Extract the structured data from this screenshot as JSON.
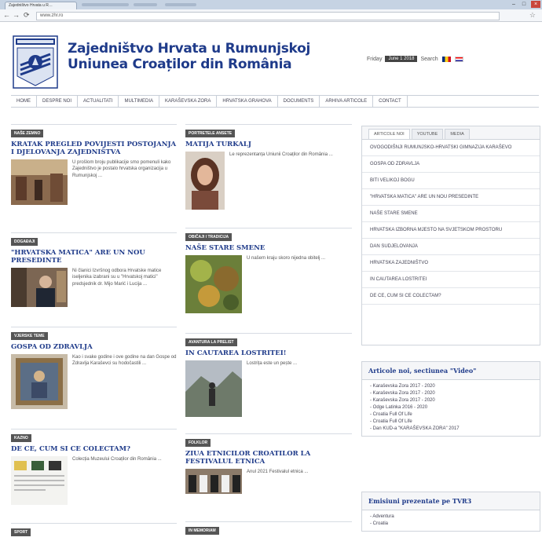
{
  "browser": {
    "tab_title": "Zajedništvo Hrvata u R…",
    "url": "www.zhr.ro"
  },
  "site": {
    "title_line1": "Zajedništvo Hrvata u Rumunjskoj",
    "title_line2": "Uniunea Croaților din România",
    "day": "Friday",
    "date": "June 1 2018",
    "search_label": "Search"
  },
  "menu": [
    "HOME",
    "DESPRE NOI",
    "ACTUALITATI",
    "MULTIMEDIA",
    "KARAŠEVSKA ZORA",
    "HRVATSKA GRAHOVA",
    "DOCUMENTS",
    "ARHIVA ARTICOLE",
    "CONTACT"
  ],
  "column1": [
    {
      "category": "NAŠE ZEMNO",
      "headline": "KRATAK PREGLED POVIJESTI POSTOJANJA I DJELOVANJA ZAJEDNIŠTVA",
      "excerpt": "U prošlom broju publikacije smo pomenuli kako Zajedništvo je postalo hrvatska organizacija u Rumunjskoj ..."
    },
    {
      "category": "DOGAĐAJI",
      "headline": "\"HRVATSKA MATICA\" ARE UN NOU PRESEDINTE",
      "excerpt": "Ni članici Izvršnog odbora Hrvatske matice iseljenika izabrani su u \"Hrvatskoj matici\" predsjednik dr. Mijo Marić i Lucija ..."
    },
    {
      "category": "VJERSKE TEME",
      "headline": "GOSPA OD ZDRAVLJA",
      "excerpt": "Kao i svake godine i ove godine na dan Gospe od Zdravlja Karaševci su hodočastili ..."
    },
    {
      "category": "KAZNO",
      "headline": "DE CE, CUM SI CE COLECTAM?",
      "excerpt": "Colecția Muzeului Croaților din România ..."
    },
    {
      "category": "SPORT",
      "headline": "",
      "excerpt": ""
    }
  ],
  "column2": [
    {
      "category": "PORTRETELE ANSETE",
      "headline": "MATIJA TURKALJ",
      "excerpt": "Le reprezentanța Uniunii Croaților din România ..."
    },
    {
      "category": "OBIČAJI I TRADICIJA",
      "headline": "NAŠE STARE SMENE",
      "excerpt": "U našem kraju skoro nijedna obitelj ..."
    },
    {
      "category": "AVANTURA LA PRELIST",
      "headline": "IN CAUTAREA LOSTRITEI!",
      "excerpt": "Lostrița este un pește ..."
    },
    {
      "category": "FOLKLOR",
      "headline": "ZIUA ETNICILOR CROATILOR LA FESTIVALUL ETNICA",
      "excerpt": "Anul 2021 Festivalul etnica ..."
    },
    {
      "category": "IN MEMORIAM",
      "headline": "",
      "excerpt": ""
    }
  ],
  "sidebar": {
    "tabs": [
      "ARTICOLE NOI",
      "YOUTUBE",
      "MEDIA"
    ],
    "articles": [
      "OVOGODIŠNJI RUMUNJSKO-HRVATSKI GIMNAZIJA KARAŠEVO",
      "GOSPA OD ZDRAVLJA",
      "BITI VELIKOJ BOGU",
      "\"HRVATSKA MATICA\" ARE UN NOU PRESEDINTE",
      "NAŠE STARE SMENE",
      "HRVATSKA IZBORNA MJESTO NA SVJETSKOM PROSTORU",
      "DAN SUDJELOVANJA",
      "HRVATSKA ZAJEDNIŠTVO",
      "IN CAUTAREA LOSTRITEI",
      "DE CE, CUM SI CE COLECTAM?"
    ],
    "video_box": {
      "title": "Articole noi, sectiunea \"Video\"",
      "items": [
        "Karaševska Zora 2017 - 2020",
        "Karaševska Zora 2017 - 2020",
        "Karaševska Zora 2017 - 2020",
        "Odge Latinka 2016 - 2020",
        "Croatia Full Of Life",
        "Croatia Full Of Life",
        "Dan KUD-a \"KARAŠEVSKA ZORA\" 2017"
      ]
    },
    "tvr_box": {
      "title": "Emisiuni prezentate pe TVR3",
      "items": [
        "Adventura",
        "Croatia"
      ]
    }
  },
  "colors": {
    "brand_blue": "#1f3b8a",
    "category_bg": "#555555"
  }
}
